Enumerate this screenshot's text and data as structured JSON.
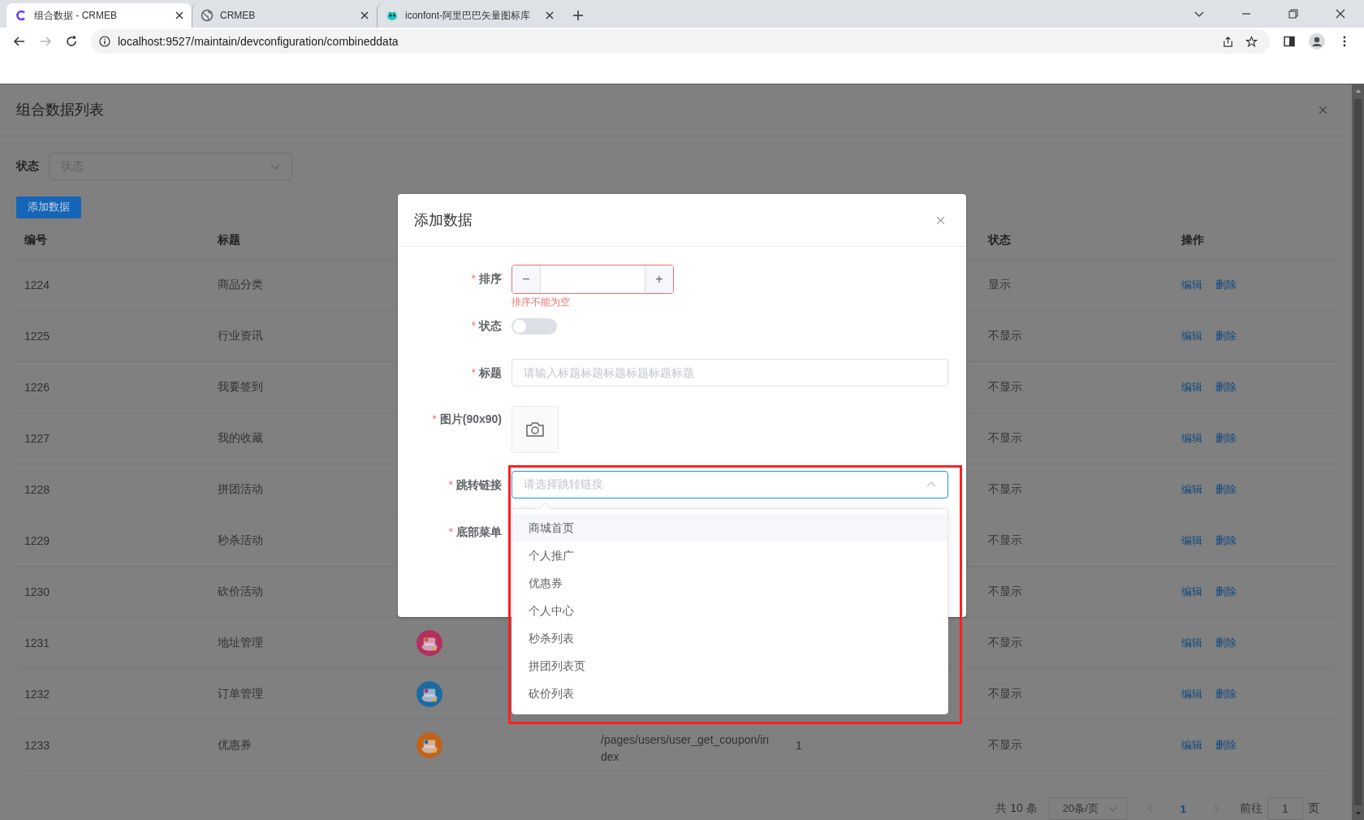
{
  "browser": {
    "tabs": [
      {
        "title": "组合数据 - CRMEB",
        "kind": "logo",
        "selected": true
      },
      {
        "title": "CRMEB",
        "kind": "globe",
        "selected": false
      },
      {
        "title": "iconfont-阿里巴巴矢量图标库",
        "kind": "iconfont",
        "selected": false
      }
    ],
    "forward_disabled": true,
    "url": "localhost:9527/maintain/devconfiguration/combineddata"
  },
  "page": {
    "title": "组合数据列表",
    "filter": {
      "label": "状态",
      "placeholder": "状态"
    },
    "add_button": "添加数据"
  },
  "table": {
    "columns": [
      "编号",
      "标题",
      "状态",
      "操作"
    ],
    "rows": [
      {
        "id": "1224",
        "title": "商品分类",
        "status": "显示",
        "actions": [
          "编辑",
          "删除"
        ]
      },
      {
        "id": "1225",
        "title": "行业资讯",
        "status": "不显示",
        "actions": [
          "编辑",
          "删除"
        ]
      },
      {
        "id": "1226",
        "title": "我要签到",
        "status": "不显示",
        "actions": [
          "编辑",
          "删除"
        ]
      },
      {
        "id": "1227",
        "title": "我的收藏",
        "status": "不显示",
        "actions": [
          "编辑",
          "删除"
        ]
      },
      {
        "id": "1228",
        "title": "拼团活动",
        "status": "不显示",
        "actions": [
          "编辑",
          "删除"
        ]
      },
      {
        "id": "1229",
        "title": "秒杀活动",
        "status": "不显示",
        "actions": [
          "编辑",
          "删除"
        ]
      },
      {
        "id": "1230",
        "title": "砍价活动",
        "status": "不显示",
        "actions": [
          "编辑",
          "删除"
        ]
      },
      {
        "id": "1231",
        "title": "地址管理",
        "image": {
          "kind": "picture"
        },
        "status": "不显示",
        "actions": [
          "编辑",
          "删除"
        ]
      },
      {
        "id": "1232",
        "title": "订单管理",
        "image": {
          "kind": "picture"
        },
        "status": "不显示",
        "actions": [
          "编辑",
          "删除"
        ]
      },
      {
        "id": "1233",
        "title": "优惠券",
        "image": {
          "kind": "picture"
        },
        "link": "/pages/users/user_get_coupon/index",
        "sort": "1",
        "status": "不显示",
        "actions": [
          "编辑",
          "删除"
        ]
      }
    ]
  },
  "pagination": {
    "total": "共 10 条",
    "page_size": "20条/页",
    "pages": [
      {
        "label": "1",
        "selected": true
      }
    ],
    "goto_label": "前往",
    "goto_value": "1",
    "page_unit": "页"
  },
  "dialog": {
    "title": "添加数据",
    "fields": [
      {
        "kind": "number",
        "label": "排序",
        "required_mark": "*",
        "minus": "−",
        "plus": "+",
        "error": "排序不能为空"
      },
      {
        "kind": "switch",
        "label": "状态",
        "required_mark": "*",
        "on": false
      },
      {
        "kind": "text",
        "label": "标题",
        "required_mark": "*",
        "placeholder": "请输入标题标题标题标题标题标题"
      },
      {
        "kind": "upload",
        "label": "图片(90x90)",
        "required_mark": "*"
      },
      {
        "kind": "select",
        "label": "跳转链接",
        "required_mark": "*",
        "placeholder": "请选择跳转链接",
        "expanded": true,
        "options": [
          {
            "label": "商城首页",
            "hovered": true
          },
          {
            "label": "个人推广",
            "hovered": false
          },
          {
            "label": "优惠券",
            "hovered": false
          },
          {
            "label": "个人中心",
            "hovered": false
          },
          {
            "label": "秒杀列表",
            "hovered": false
          },
          {
            "label": "拼团列表页",
            "hovered": false
          },
          {
            "label": "砍价列表",
            "hovered": false
          }
        ]
      },
      {
        "kind": "select",
        "label": "底部菜单",
        "required_mark": "*"
      }
    ]
  }
}
